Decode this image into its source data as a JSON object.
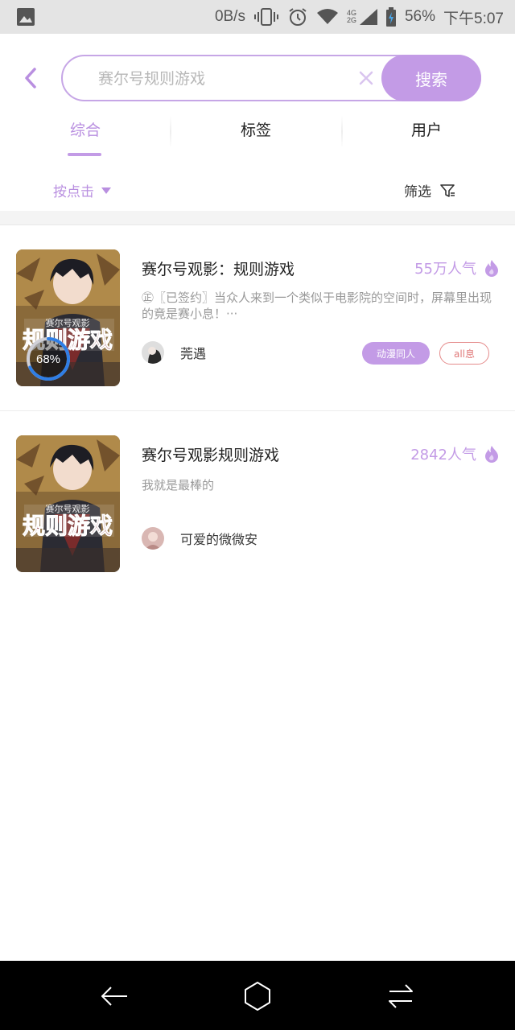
{
  "status_bar": {
    "net_speed": "0B/s",
    "network": "4G\n2G",
    "battery": "56%",
    "time": "下午5:07",
    "icons": [
      "image-icon",
      "vibrate-icon",
      "alarm-icon",
      "wifi-icon",
      "signal-icon",
      "battery-icon"
    ]
  },
  "search": {
    "placeholder": "赛尔号规则游戏",
    "button_label": "搜索"
  },
  "tabs": [
    {
      "label": "综合",
      "active": true
    },
    {
      "label": "标签",
      "active": false
    },
    {
      "label": "用户",
      "active": false
    }
  ],
  "sort": {
    "label": "按点击"
  },
  "filter": {
    "label": "筛选"
  },
  "accent_color": "#c39be6",
  "results": [
    {
      "title": "赛尔号观影：规则游戏",
      "popularity": "55万人气",
      "description": "㊣〖已签约〗当众人来到一个类似于电影院的空间时，屏幕里出现的竟是赛小息！···",
      "author": "莞遇",
      "tags": [
        "动漫同人",
        "all息"
      ],
      "progress_label": "68%",
      "progress": 0.68
    },
    {
      "title": "赛尔号观影规则游戏",
      "popularity": "2842人气",
      "description": "我就是最棒的",
      "author": "可爱的微微安",
      "tags": []
    }
  ],
  "navbar": {
    "icons": [
      "back-arrow-icon",
      "home-icon",
      "switch-apps-icon"
    ]
  }
}
